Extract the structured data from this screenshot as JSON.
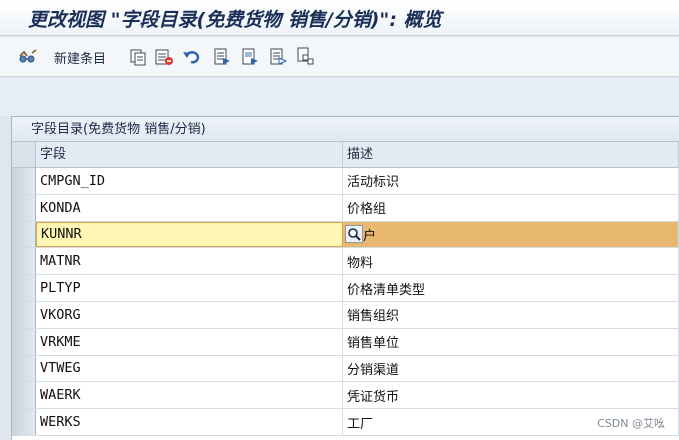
{
  "window": {
    "title": "更改视图 \"字段目录(免费货物 销售/分销)\": 概览"
  },
  "toolbar": {
    "new_entries_label": "新建条目",
    "icons": [
      "glasses-icon",
      "copy-icon",
      "delete-icon",
      "undo-icon",
      "select-all-icon",
      "select-block-icon",
      "deselect-all-icon",
      "copy-entries-icon"
    ]
  },
  "panel": {
    "title": "字段目录(免费货物 销售/分销)",
    "columns": [
      "字段",
      "描述"
    ],
    "rows": [
      {
        "field": "CMPGN_ID",
        "desc": "活动标识"
      },
      {
        "field": "KONDA",
        "desc": "价格组"
      },
      {
        "field": "KUNNR",
        "desc": "户",
        "selected": true
      },
      {
        "field": "MATNR",
        "desc": "物料"
      },
      {
        "field": "PLTYP",
        "desc": "价格清单类型"
      },
      {
        "field": "VKORG",
        "desc": "销售组织"
      },
      {
        "field": "VRKME",
        "desc": "销售单位"
      },
      {
        "field": "VTWEG",
        "desc": "分销渠道"
      },
      {
        "field": "WAERK",
        "desc": "凭证货币"
      },
      {
        "field": "WERKS",
        "desc": "工厂"
      }
    ]
  },
  "watermark": "CSDN @艾吆",
  "colors": {
    "title": "#1a2f57",
    "selected_row": "#e8b770",
    "selected_cell": "#fff7b3"
  }
}
